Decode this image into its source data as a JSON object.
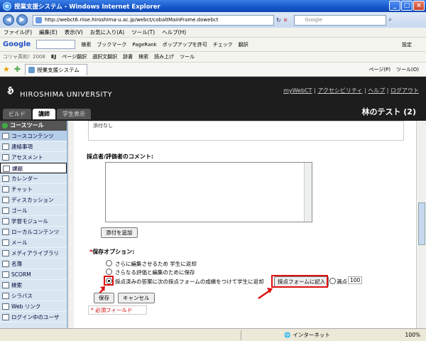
{
  "window": {
    "title": "授業支援システム - Windows Internet Explorer"
  },
  "address": {
    "url": "http://webct6.riise.hiroshima-u.ac.jp/webct/cobaltMainFrame.dowebct",
    "search_placeholder": "Google"
  },
  "menu": [
    "ファイル(F)",
    "編集(E)",
    "表示(V)",
    "お気に入り(A)",
    "ツール(T)",
    "ヘルプ(H)"
  ],
  "google_toolbar": {
    "logo": "Google",
    "items": [
      "検索",
      "ブックマーク",
      "PageRank",
      "ポップアップを許可",
      "チェック",
      "翻訳",
      "設定"
    ]
  },
  "links_toolbar": [
    "コリャ英和！2008",
    "EJ",
    "ページ翻訳",
    "選択文翻訳",
    "辞書",
    "検索",
    "読み上げ",
    "ツール"
  ],
  "tab": {
    "label": "授業支援システム"
  },
  "fav_right": [
    "ページ(P)",
    "ツール(O)"
  ],
  "header": {
    "university": "HIROSHIMA UNIVERSITY",
    "links": [
      "myWebCT",
      "アクセシビリティ",
      "ヘルプ",
      "ログアウト"
    ],
    "user": "林のテスト (2)",
    "tabs": [
      "ビルド",
      "講師",
      "学生表示"
    ]
  },
  "sidebar": {
    "heading": "コースツール",
    "items": [
      "コースコンテンツ",
      "連絡事項",
      "アセスメント",
      "課題",
      "カレンダー",
      "チャット",
      "ディスカッション",
      "ゴール",
      "学習モジュール",
      "ローカルコンテンツ",
      "メール",
      "メディアライブラリ",
      "名簿",
      "SCORM",
      "検索",
      "シラバス",
      "Web リンク",
      "ログイン中のユーザ"
    ]
  },
  "main": {
    "prev_box_text": "添付なし",
    "comment_label": "採点者/評価者のコメント:",
    "attach_button": "添付を追加",
    "options_label": "保存オプション:",
    "required_mark": "*",
    "options": [
      "さらに編集させるため 学生に返却",
      "さらなる評価と編集のために保存",
      "採点済みの答案に次の採点フォームの成績をつけて学生に返却"
    ],
    "form_button": "採点フォームに記入",
    "score_label": "満点",
    "score_value": "100",
    "save_button": "保存",
    "cancel_button": "キャンセル",
    "required_field": "* 必須フィールド"
  },
  "status": {
    "zone": "インターネット",
    "zoom": "100%"
  }
}
